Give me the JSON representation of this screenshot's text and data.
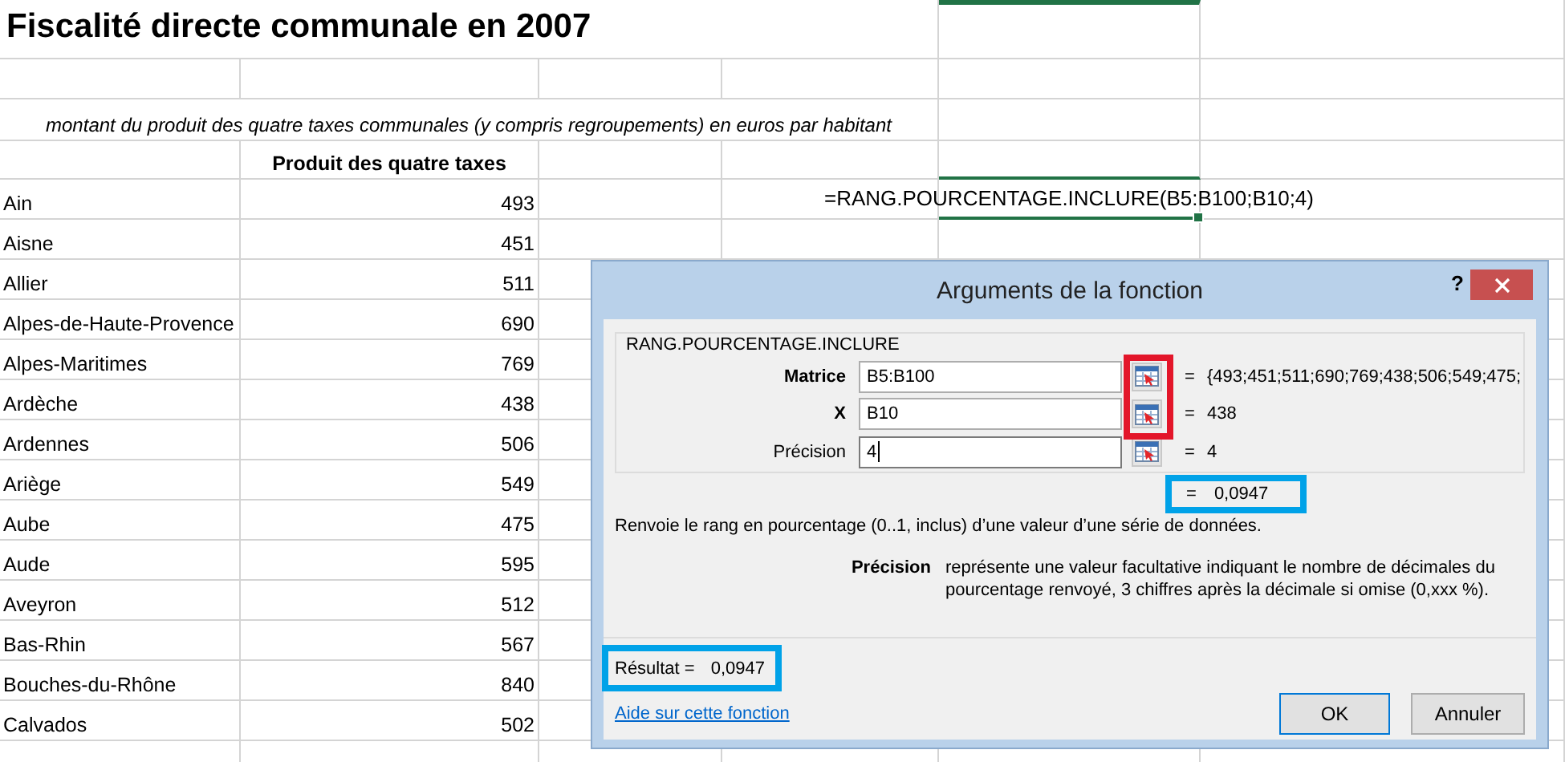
{
  "sheet": {
    "title": "Fiscalité directe communale en 2007",
    "subtitle": "montant du produit des quatre taxes communales (y compris regroupements) en euros par habitant",
    "column_header": "Produit des quatre taxes",
    "formula_cell": {
      "text": "=RANG.POURCENTAGE.INCLURE(B5:B100;B10;4)",
      "selected": true
    },
    "rows": [
      {
        "name": "Ain",
        "value": "493"
      },
      {
        "name": "Aisne",
        "value": "451"
      },
      {
        "name": "Allier",
        "value": "511"
      },
      {
        "name": "Alpes-de-Haute-Provence",
        "value": "690"
      },
      {
        "name": "Alpes-Maritimes",
        "value": "769"
      },
      {
        "name": "Ardèche",
        "value": "438"
      },
      {
        "name": "Ardennes",
        "value": "506"
      },
      {
        "name": "Ariège",
        "value": "549"
      },
      {
        "name": "Aube",
        "value": "475"
      },
      {
        "name": "Aude",
        "value": "595"
      },
      {
        "name": "Aveyron",
        "value": "512"
      },
      {
        "name": "Bas-Rhin",
        "value": "567"
      },
      {
        "name": "Bouches-du-Rhône",
        "value": "840"
      },
      {
        "name": "Calvados",
        "value": "502"
      }
    ]
  },
  "dialog": {
    "title": "Arguments de la fonction",
    "help_button": "?",
    "function_name": "RANG.POURCENTAGE.INCLURE",
    "arguments": [
      {
        "label": "Matrice",
        "bold": true,
        "value": "B5:B100",
        "equals": "=",
        "result": "{493;451;511;690;769;438;506;549;475;",
        "highlighted": true,
        "focused": false
      },
      {
        "label": "X",
        "bold": true,
        "value": "B10",
        "equals": "=",
        "result": "438",
        "highlighted": true,
        "focused": false
      },
      {
        "label": "Précision",
        "bold": false,
        "value": "4",
        "equals": "=",
        "result": "4",
        "highlighted": false,
        "focused": true
      }
    ],
    "formula_result": {
      "equals": "=",
      "value": "0,0947",
      "highlighted": true
    },
    "description": "Renvoie le rang en pourcentage (0..1, inclus) d’une valeur d’une série de données.",
    "parameter": {
      "name": "Précision",
      "description": "représente une valeur facultative indiquant le nombre de décimales du pourcentage renvoyé, 3 chiffres après la décimale si omise (0,xxx %)."
    },
    "result": {
      "label": "Résultat =",
      "value": "0,0947",
      "highlighted": true
    },
    "help_link": "Aide sur cette fonction",
    "buttons": [
      "OK",
      "Annuler"
    ]
  }
}
